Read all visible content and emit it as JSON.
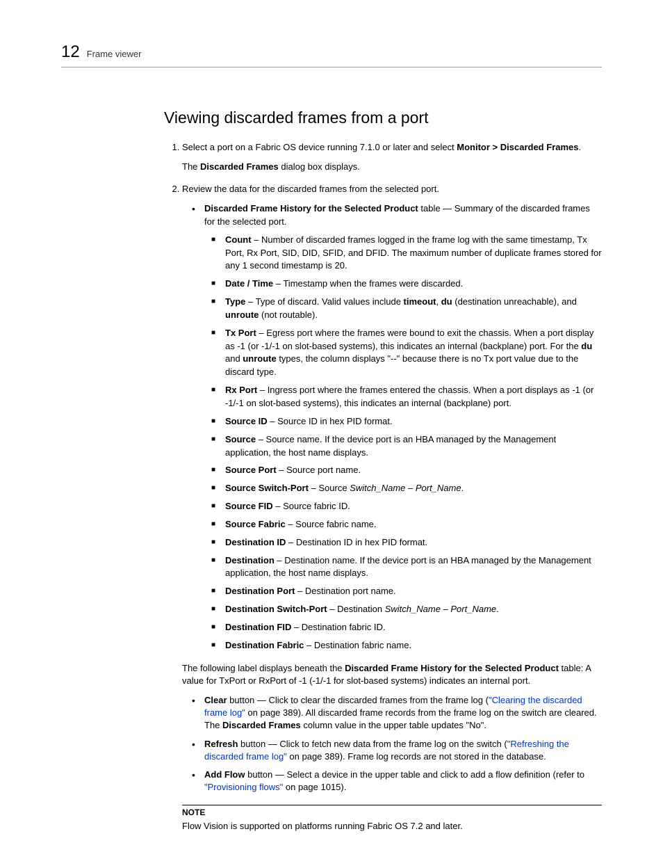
{
  "header": {
    "page_number": "12",
    "section": "Frame viewer"
  },
  "title": "Viewing discarded frames from a port",
  "step1": {
    "pre": "Select a port on a Fabric OS device running 7.1.0 or later and select ",
    "bold": "Monitor > Discarded Frames",
    "post": ".",
    "sub_pre": "The ",
    "sub_bold": "Discarded Frames",
    "sub_post": " dialog box displays."
  },
  "step2": {
    "text": "Review the data for the discarded frames from the selected port.",
    "bullet1": {
      "bold": "Discarded Frame History for the Selected Product",
      "post": " table — Summary of the discarded frames for the selected port."
    },
    "squares": {
      "count": {
        "b": "Count",
        "t": " – Number of discarded frames logged in the frame log with the same timestamp, Tx Port, Rx Port, SID, DID, SFID, and DFID. The maximum number of duplicate frames stored for any 1 second timestamp is 20."
      },
      "datetime": {
        "b": "Date / Time",
        "t": " – Timestamp when the frames were discarded."
      },
      "type": {
        "b": "Type",
        "t1": " – Type of discard. Valid values include ",
        "b2": "timeout",
        "sep": ", ",
        "b3": "du",
        "t2": " (destination unreachable), and ",
        "b4": "unroute",
        "t3": " (not routable)."
      },
      "txport": {
        "b": "Tx Port",
        "t1": " – Egress port where the frames were bound to exit the chassis. When a port display as -1 (or -1/-1 on slot-based systems), this indicates an internal (backplane) port. For the ",
        "b2": "du",
        "t2": " and ",
        "b3": "unroute",
        "t3": " types, the column displays \"--\" because there is no Tx port value due to the discard type."
      },
      "rxport": {
        "b": "Rx Port",
        "t": " – Ingress port where the frames entered the chassis. When a port displays as -1 (or -1/-1 on slot-based systems), this indicates an internal (backplane) port."
      },
      "sourceid": {
        "b": "Source ID",
        "t": " – Source ID in hex PID format."
      },
      "source": {
        "b": "Source",
        "t": " – Source name. If the device port is an HBA managed by the Management application, the host name displays."
      },
      "sourceport": {
        "b": "Source Port",
        "t": " – Source port name."
      },
      "sourceswitchport": {
        "b": "Source Switch-Port",
        "t1": " – Source ",
        "i": "Switch_Name – Port_Name",
        "t2": "."
      },
      "sourcefid": {
        "b": "Source FID",
        "t": " – Source fabric ID."
      },
      "sourcefabric": {
        "b": "Source Fabric",
        "t": " – Source fabric name."
      },
      "destid": {
        "b": "Destination ID",
        "t": " – Destination ID in hex PID format."
      },
      "dest": {
        "b": "Destination",
        "t": " – Destination name. If the device port is an HBA managed by the Management application, the host name displays."
      },
      "destport": {
        "b": "Destination Port",
        "t": " – Destination port name."
      },
      "destswitchport": {
        "b": "Destination Switch-Port",
        "t1": " – Destination ",
        "i": "Switch_Name – Port_Name",
        "t2": "."
      },
      "destfid": {
        "b": "Destination FID",
        "t": " – Destination fabric ID."
      },
      "destfabric": {
        "b": "Destination Fabric",
        "t": " – Destination fabric name."
      }
    }
  },
  "para_after": {
    "t1": "The following label displays beneath the ",
    "b": "Discarded Frame History for the Selected Product",
    "t2": " table: A value for TxPort or RxPort of -1 (-1/-1 for slot-based systems) indicates an internal port."
  },
  "bullets2": {
    "clear": {
      "b": "Clear",
      "t1": " button — Click to clear the discarded frames from the frame log (",
      "link": "\"Clearing the discarded frame log\"",
      "t2": " on page 389). All discarded frame records from the frame log on the switch are cleared. The ",
      "b2": "Discarded Frames",
      "t3": " column value in the upper table updates \"No\"."
    },
    "refresh": {
      "b": "Refresh",
      "t1": " button — Click to fetch new data from the frame log on the switch (",
      "link": "\"Refreshing the discarded frame log\"",
      "t2": " on page 389). Frame log records are not stored in the database."
    },
    "addflow": {
      "b": "Add Flow",
      "t1": " button — Select a device in the upper table and click to add a flow definition (refer to ",
      "link": "\"Provisioning flows\"",
      "t2": " on page 1015)."
    }
  },
  "note": {
    "label": "NOTE",
    "text": "Flow Vision is supported on platforms running Fabric OS 7.2 and later."
  }
}
